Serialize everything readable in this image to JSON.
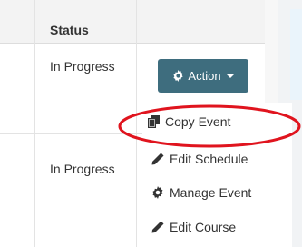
{
  "table": {
    "header": {
      "status_label": "Status"
    },
    "rows": [
      {
        "status": "In Progress"
      },
      {
        "status": "In Progress"
      }
    ]
  },
  "action_button": {
    "label": "Action",
    "icon": "gear-icon"
  },
  "dropdown": {
    "items": [
      {
        "label": "Copy Event",
        "icon": "copy-icon"
      },
      {
        "label": "Edit Schedule",
        "icon": "pencil-icon"
      },
      {
        "label": "Manage Event",
        "icon": "gear-icon"
      },
      {
        "label": "Edit Course",
        "icon": "pencil-icon"
      }
    ]
  },
  "colors": {
    "action_button": "#3e6d7e",
    "annotation": "#e0141e",
    "header_bg": "#f3f3f3"
  }
}
